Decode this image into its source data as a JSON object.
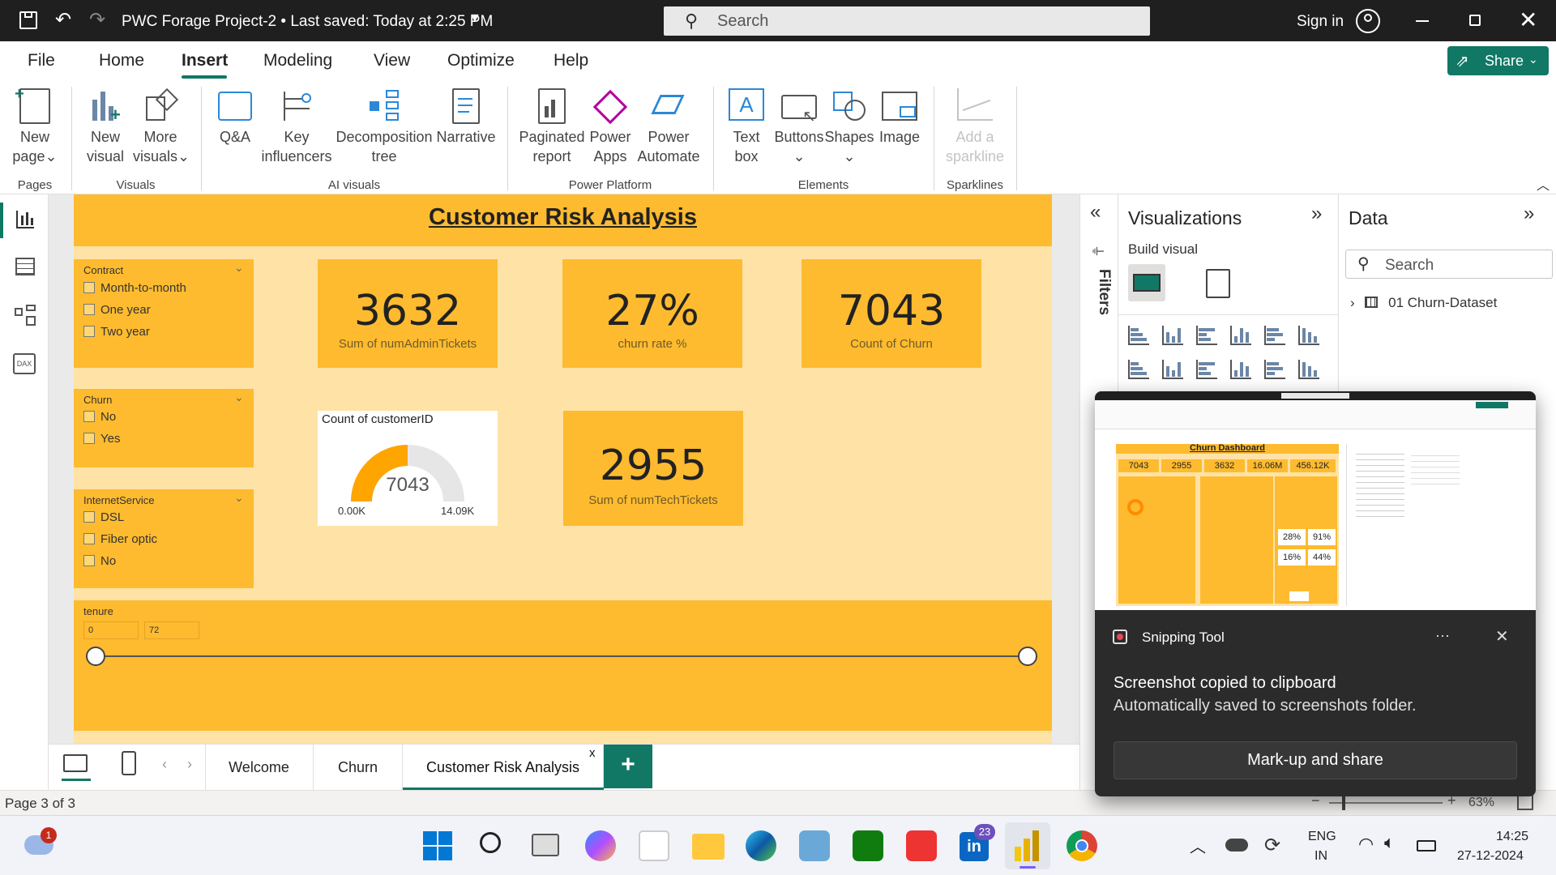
{
  "titlebar": {
    "title": "PWC Forage Project-2 • Last saved: Today at 2:25 PM",
    "search_placeholder": "Search",
    "sign_in": "Sign in"
  },
  "menu": {
    "items": [
      "File",
      "Home",
      "Insert",
      "Modeling",
      "View",
      "Optimize",
      "Help"
    ],
    "active": "Insert",
    "share": "Share"
  },
  "ribbon": {
    "new_page": [
      "New",
      "page"
    ],
    "new_visual": [
      "New",
      "visual"
    ],
    "more_visuals": [
      "More",
      "visuals"
    ],
    "qa": "Q&A",
    "key_influencers": [
      "Key",
      "influencers"
    ],
    "decomposition_tree": [
      "Decomposition",
      "tree"
    ],
    "narrative": "Narrative",
    "paginated_report": [
      "Paginated",
      "report"
    ],
    "power_apps": [
      "Power",
      "Apps"
    ],
    "power_automate": [
      "Power",
      "Automate"
    ],
    "text_box": [
      "Text",
      "box"
    ],
    "buttons": "Buttons",
    "shapes": "Shapes",
    "image": "Image",
    "add_sparkline": [
      "Add a",
      "sparkline"
    ],
    "groups": {
      "pages": "Pages",
      "visuals": "Visuals",
      "ai_visuals": "AI visuals",
      "power_platform": "Power Platform",
      "elements": "Elements",
      "sparklines": "Sparklines"
    }
  },
  "report": {
    "title": "Customer Risk Analysis",
    "slicers": {
      "contract": {
        "title": "Contract",
        "options": [
          "Month-to-month",
          "One year",
          "Two year"
        ]
      },
      "churn": {
        "title": "Churn",
        "options": [
          "No",
          "Yes"
        ]
      },
      "internet": {
        "title": "InternetService",
        "options": [
          "DSL",
          "Fiber optic",
          "No"
        ]
      },
      "tenure": {
        "title": "tenure",
        "min": "0",
        "max": "72"
      }
    },
    "cards": {
      "admin": {
        "value": "3632",
        "label": "Sum of numAdminTickets"
      },
      "churn_rate": {
        "value": "27%",
        "label": "churn rate %"
      },
      "count_churn": {
        "value": "7043",
        "label": "Count of Churn"
      },
      "tech": {
        "value": "2955",
        "label": "Sum of numTechTickets"
      }
    },
    "gauge": {
      "title": "Count of customerID",
      "value": "7043",
      "min": "0.00K",
      "max": "14.09K",
      "fraction": 0.5
    }
  },
  "panels": {
    "filters_label": "Filters",
    "visualizations_title": "Visualizations",
    "build_visual": "Build visual",
    "data_title": "Data",
    "data_search_placeholder": "Search",
    "dataset": "01 Churn-Dataset"
  },
  "page_tabs": {
    "tabs": [
      "Welcome",
      "Churn",
      "Customer Risk Analysis"
    ],
    "active": "Customer Risk Analysis",
    "close": "x",
    "add": "+"
  },
  "status": {
    "page": "Page 3 of 3",
    "zoom": "63%"
  },
  "toast": {
    "app": "Snipping Tool",
    "more": "⋯",
    "close": "✕",
    "title": "Screenshot copied to clipboard",
    "body": "Automatically saved to screenshots folder.",
    "button": "Mark-up and share",
    "thumb": {
      "dashboard_title": "Churn Dashboard",
      "kpis": [
        "7043",
        "2955",
        "3632",
        "16.06M",
        "456.12K"
      ],
      "pcts": [
        "28%",
        "91%",
        "16%",
        "44%"
      ]
    }
  },
  "taskbar": {
    "weather_badge": "1",
    "linkedin_badge": "23",
    "lang": "ENG",
    "region": "IN",
    "time": "14:25",
    "date": "27-12-2024"
  },
  "colors": {
    "accent": "#febb2f",
    "page_bg": "#ffe3a6",
    "brand_green": "#117865",
    "titlebar": "#1f1f1f",
    "gauge_fill": "#ffa500",
    "gauge_track": "#e6e6e6"
  }
}
